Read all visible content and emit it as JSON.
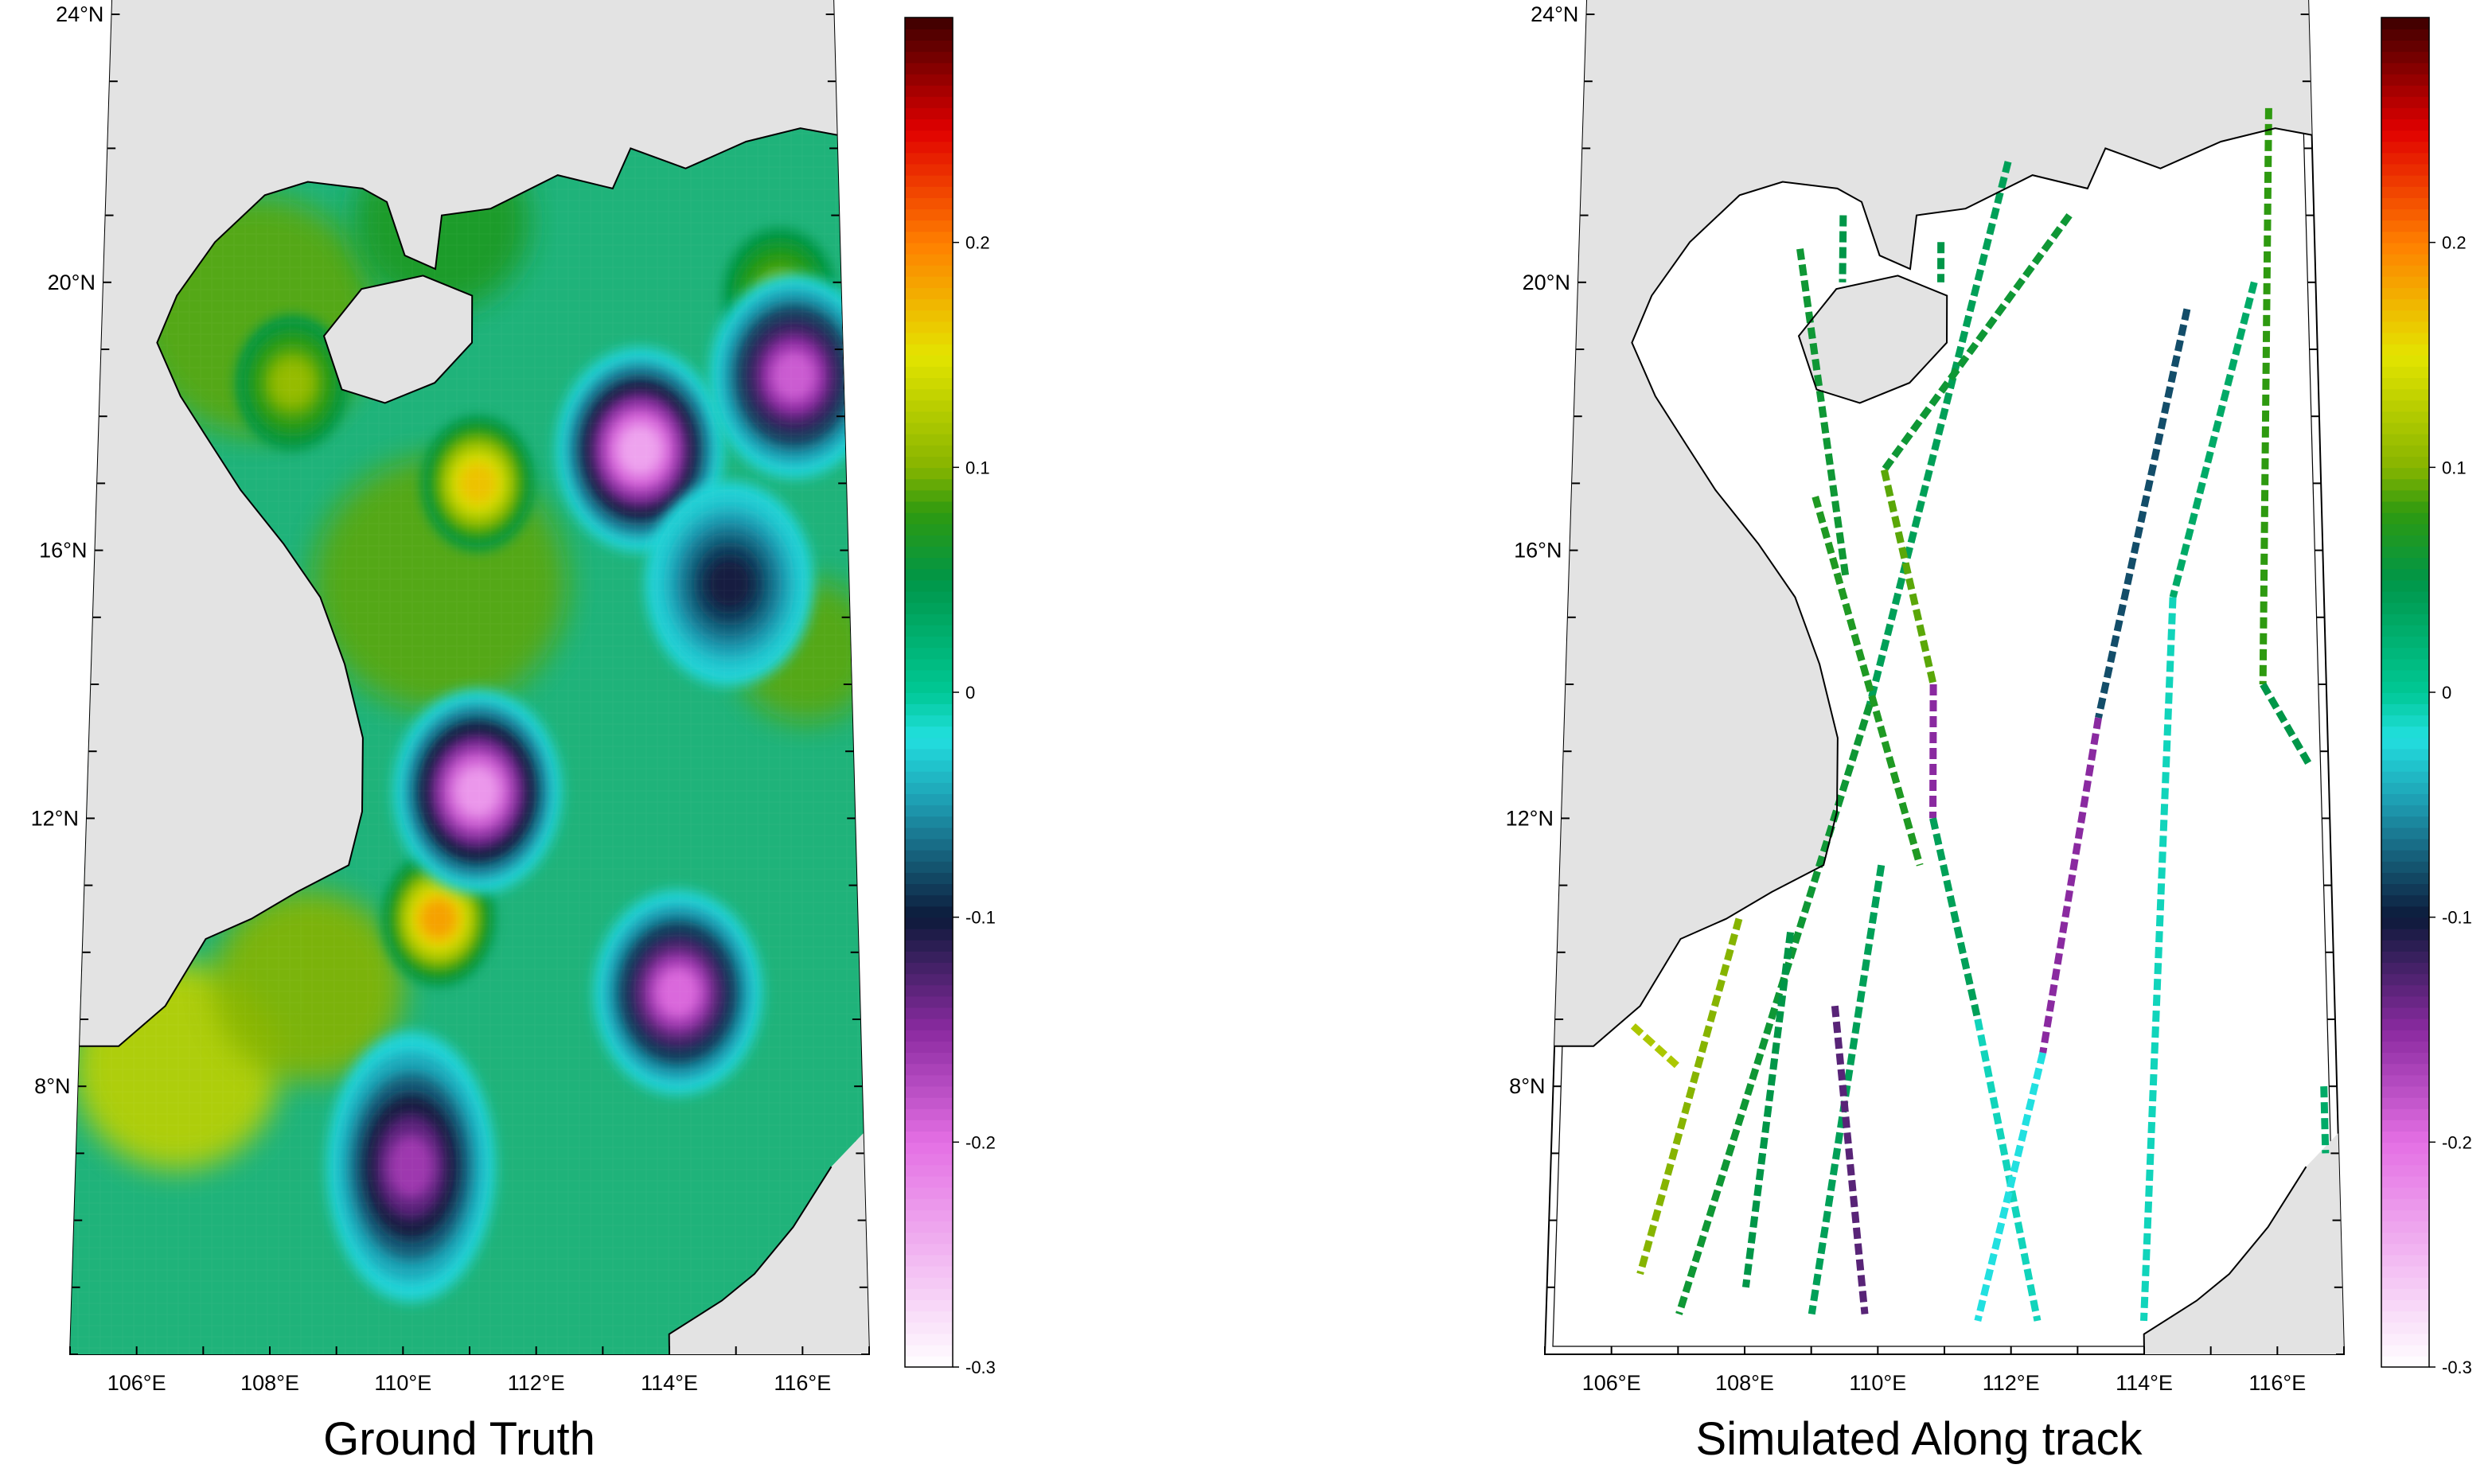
{
  "panels": [
    {
      "id": "ground-truth",
      "title": "Ground Truth"
    },
    {
      "id": "simulated",
      "title": "Simulated Along track"
    }
  ],
  "axes": {
    "lat_labels": [
      {
        "value": 24,
        "text": "24°N"
      },
      {
        "value": 20,
        "text": "20°N"
      },
      {
        "value": 16,
        "text": "16°N"
      },
      {
        "value": 12,
        "text": "12°N"
      },
      {
        "value": 8,
        "text": "8°N"
      }
    ],
    "lon_labels": [
      {
        "value": 106,
        "text": "106°E"
      },
      {
        "value": 108,
        "text": "108°E"
      },
      {
        "value": 110,
        "text": "110°E"
      },
      {
        "value": 112,
        "text": "112°E"
      },
      {
        "value": 114,
        "text": "114°E"
      },
      {
        "value": 116,
        "text": "116°E"
      }
    ]
  },
  "colorbar": {
    "min": -0.3,
    "max": 0.3,
    "ticks": [
      {
        "value": 0.2,
        "text": "0.2"
      },
      {
        "value": 0.1,
        "text": "0.1"
      },
      {
        "value": 0,
        "text": "0"
      },
      {
        "value": -0.1,
        "text": "-0.1"
      },
      {
        "value": -0.2,
        "text": "-0.2"
      },
      {
        "value": -0.3,
        "text": "-0.3"
      }
    ],
    "stops": [
      {
        "value": -0.3,
        "color": "#ffffff"
      },
      {
        "value": -0.2,
        "color": "#e46fe4"
      },
      {
        "value": -0.15,
        "color": "#8a2aa0"
      },
      {
        "value": -0.1,
        "color": "#0c1a3a"
      },
      {
        "value": -0.05,
        "color": "#1e9ab0"
      },
      {
        "value": -0.02,
        "color": "#22e0e0"
      },
      {
        "value": 0.0,
        "color": "#00c896"
      },
      {
        "value": 0.05,
        "color": "#009648"
      },
      {
        "value": 0.08,
        "color": "#2e9a10"
      },
      {
        "value": 0.1,
        "color": "#86b400"
      },
      {
        "value": 0.15,
        "color": "#e4e400"
      },
      {
        "value": 0.2,
        "color": "#ff7f00"
      },
      {
        "value": 0.25,
        "color": "#e00000"
      },
      {
        "value": 0.3,
        "color": "#3c0000"
      }
    ]
  },
  "colors": {
    "land": "#e3e3e3",
    "coastline": "#000000",
    "background_field": "#1fb37a"
  },
  "chart_data": [
    {
      "type": "heatmap",
      "panel": "ground-truth",
      "lon_range": [
        105,
        117
      ],
      "lat_range": [
        4,
        25
      ],
      "features": [
        {
          "kind": "anticyclone",
          "lon": 108.1,
          "lat": 18.5,
          "value": 0.12
        },
        {
          "kind": "anticyclone",
          "lon": 111.1,
          "lat": 17.0,
          "value": 0.19
        },
        {
          "kind": "anticyclone",
          "lon": 110.5,
          "lat": 10.5,
          "value": 0.21
        },
        {
          "kind": "anticyclone",
          "lon": 116.0,
          "lat": 19.8,
          "value": 0.11
        },
        {
          "kind": "cyclone",
          "lon": 113.7,
          "lat": 17.5,
          "value": -0.28
        },
        {
          "kind": "cyclone",
          "lon": 116.2,
          "lat": 18.6,
          "value": -0.22
        },
        {
          "kind": "cyclone",
          "lon": 115.1,
          "lat": 15.5,
          "value": -0.12
        },
        {
          "kind": "cyclone",
          "lon": 111.1,
          "lat": 12.4,
          "value": -0.27
        },
        {
          "kind": "cyclone",
          "lon": 114.2,
          "lat": 9.4,
          "value": -0.23
        },
        {
          "kind": "cyclone",
          "lon": 110.1,
          "lat": 6.8,
          "value": -0.19
        }
      ]
    },
    {
      "type": "scatter",
      "panel": "simulated",
      "tracks": [
        {
          "from": [
            108.6,
            20.5
          ],
          "to": [
            109.4,
            15.6
          ],
          "value": 0.06
        },
        {
          "from": [
            109.3,
            21.0
          ],
          "to": [
            109.3,
            20.0
          ],
          "value": 0.05
        },
        {
          "from": [
            110.9,
            20.6
          ],
          "to": [
            110.9,
            20.0
          ],
          "value": 0.05
        },
        {
          "from": [
            112.0,
            21.8
          ],
          "to": [
            109.8,
            13.7
          ],
          "value": 0.04
        },
        {
          "from": [
            109.8,
            13.7
          ],
          "to": [
            107.0,
            4.6
          ],
          "value": 0.06
        },
        {
          "from": [
            113.0,
            21.0
          ],
          "to": [
            110.0,
            17.2
          ],
          "value": 0.06
        },
        {
          "from": [
            110.0,
            17.2
          ],
          "to": [
            110.8,
            14.0
          ],
          "value": 0.09
        },
        {
          "from": [
            110.8,
            14.0
          ],
          "to": [
            110.8,
            12.0
          ],
          "value": -0.15
        },
        {
          "from": [
            110.8,
            12.0
          ],
          "to": [
            111.5,
            9.0
          ],
          "value": 0.04
        },
        {
          "from": [
            111.5,
            9.0
          ],
          "to": [
            112.4,
            4.5
          ],
          "value": -0.01
        },
        {
          "from": [
            114.9,
            19.6
          ],
          "to": [
            113.4,
            13.5
          ],
          "value": -0.08
        },
        {
          "from": [
            113.4,
            13.5
          ],
          "to": [
            112.5,
            8.5
          ],
          "value": -0.15
        },
        {
          "from": [
            112.5,
            8.5
          ],
          "to": [
            111.5,
            4.5
          ],
          "value": -0.02
        },
        {
          "from": [
            116.0,
            20.0
          ],
          "to": [
            114.6,
            15.3
          ],
          "value": 0.03
        },
        {
          "from": [
            114.6,
            15.3
          ],
          "to": [
            114.0,
            4.5
          ],
          "value": -0.01
        },
        {
          "from": [
            116.3,
            22.6
          ],
          "to": [
            116.0,
            14.0
          ],
          "value": 0.08
        },
        {
          "from": [
            116.0,
            14.0
          ],
          "to": [
            116.7,
            12.8
          ],
          "value": 0.05
        },
        {
          "from": [
            108.9,
            16.8
          ],
          "to": [
            110.6,
            11.3
          ],
          "value": 0.07
        },
        {
          "from": [
            110.0,
            11.3
          ],
          "to": [
            109.0,
            4.6
          ],
          "value": 0.04
        },
        {
          "from": [
            107.8,
            10.5
          ],
          "to": [
            106.4,
            5.2
          ],
          "value": 0.1
        },
        {
          "from": [
            108.6,
            10.3
          ],
          "to": [
            108.0,
            5.0
          ],
          "value": 0.05
        },
        {
          "from": [
            109.3,
            9.2
          ],
          "to": [
            109.8,
            4.6
          ],
          "value": -0.13
        },
        {
          "from": [
            106.2,
            8.9
          ],
          "to": [
            106.9,
            8.3
          ],
          "value": 0.12
        },
        {
          "from": [
            116.8,
            8.0
          ],
          "to": [
            116.8,
            7.0
          ],
          "value": 0.03
        }
      ]
    }
  ]
}
